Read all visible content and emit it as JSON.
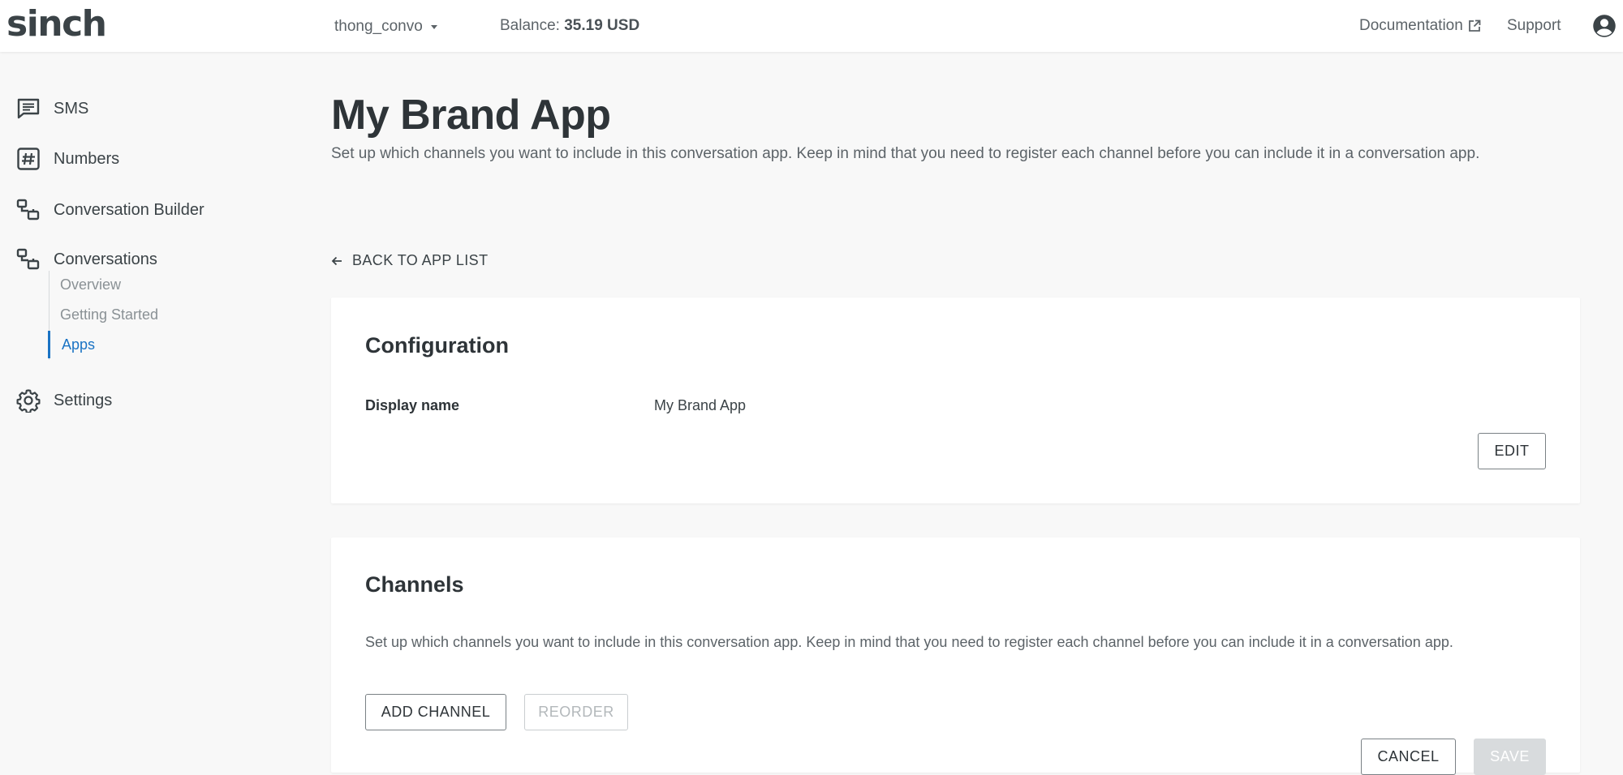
{
  "topbar": {
    "logo": "sinch",
    "account_name": "thong_convo",
    "balance_label": "Balance:",
    "balance_value": "35.19 USD",
    "documentation": "Documentation",
    "support": "Support"
  },
  "sidebar": {
    "items": [
      {
        "label": "SMS",
        "icon": "sms-icon"
      },
      {
        "label": "Numbers",
        "icon": "hash-icon"
      },
      {
        "label": "Conversation Builder",
        "icon": "conversation-icon"
      },
      {
        "label": "Conversations",
        "icon": "conversation-icon"
      },
      {
        "label": "Settings",
        "icon": "gear-icon"
      }
    ],
    "sub_items": [
      {
        "label": "Overview"
      },
      {
        "label": "Getting Started"
      },
      {
        "label": "Apps",
        "active": true
      }
    ]
  },
  "main": {
    "title": "My Brand App",
    "description": "Set up which channels you want to include in this conversation app. Keep in mind that you need to register each channel before you can include it in a conversation app.",
    "back_link": "BACK TO APP LIST",
    "configuration": {
      "title": "Configuration",
      "display_name_label": "Display name",
      "display_name_value": "My Brand App",
      "edit_label": "EDIT"
    },
    "channels": {
      "title": "Channels",
      "description": "Set up which channels you want to include in this conversation app. Keep in mind that you need to register each channel before you can include it in a conversation app.",
      "add_channel_label": "ADD CHANNEL",
      "reorder_label": "REORDER",
      "cancel_label": "CANCEL",
      "save_label": "SAVE"
    }
  },
  "colors": {
    "accent": "#1a73c4",
    "text": "#2e3438",
    "muted": "#5c6368"
  }
}
